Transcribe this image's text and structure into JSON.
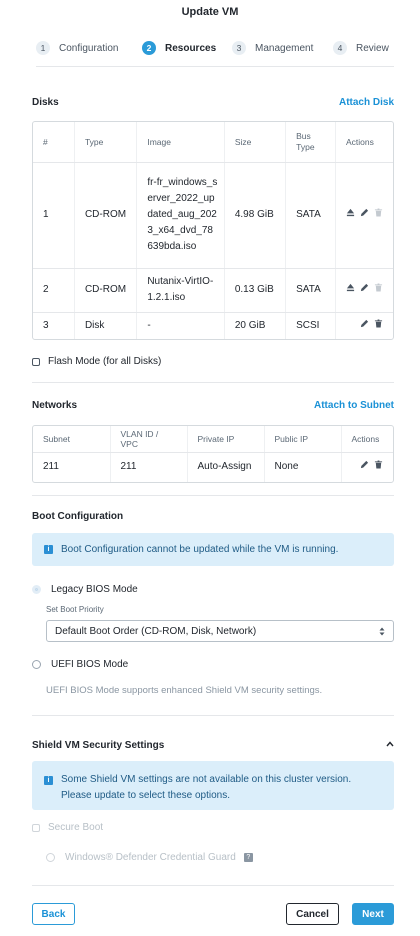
{
  "header": {
    "title": "Update VM"
  },
  "steps": [
    {
      "num": "1",
      "label": "Configuration"
    },
    {
      "num": "2",
      "label": "Resources"
    },
    {
      "num": "3",
      "label": "Management"
    },
    {
      "num": "4",
      "label": "Review"
    }
  ],
  "disks": {
    "title": "Disks",
    "attach_link": "Attach Disk",
    "columns": [
      "#",
      "Type",
      "Image",
      "Size",
      "Bus Type",
      "Actions"
    ],
    "rows": [
      {
        "num": "1",
        "type": "CD-ROM",
        "image": "fr-fr_windows_server_2022_updated_aug_2023_x64_dvd_78639bda.iso",
        "size": "4.98 GiB",
        "bus": "SATA"
      },
      {
        "num": "2",
        "type": "CD-ROM",
        "image": "Nutanix-VirtIO-1.2.1.iso",
        "size": "0.13 GiB",
        "bus": "SATA"
      },
      {
        "num": "3",
        "type": "Disk",
        "image": "-",
        "size": "20 GiB",
        "bus": "SCSI"
      }
    ],
    "flash_mode_label": "Flash Mode (for all Disks)"
  },
  "networks": {
    "title": "Networks",
    "attach_link": "Attach to Subnet",
    "columns": [
      "Subnet",
      "VLAN ID / VPC",
      "Private IP",
      "Public IP",
      "Actions"
    ],
    "rows": [
      {
        "subnet": "211",
        "vlan": "211",
        "private_ip": "Auto-Assign",
        "public_ip": "None"
      }
    ]
  },
  "boot": {
    "title": "Boot Configuration",
    "info": "Boot Configuration cannot be updated while the VM is running.",
    "legacy_label": "Legacy BIOS Mode",
    "priority_label": "Set Boot Priority",
    "priority_value": "Default Boot Order (CD-ROM, Disk, Network)",
    "uefi_label": "UEFI BIOS Mode",
    "uefi_note": "UEFI BIOS Mode supports enhanced Shield VM security settings."
  },
  "shield": {
    "title": "Shield VM Security Settings",
    "info": "Some Shield VM settings are not available on this cluster version. Please update to select these options.",
    "secure_boot": "Secure Boot",
    "credential_guard": "Windows® Defender Credential Guard",
    "help": "?"
  },
  "footer": {
    "back": "Back",
    "cancel": "Cancel",
    "next": "Next"
  }
}
